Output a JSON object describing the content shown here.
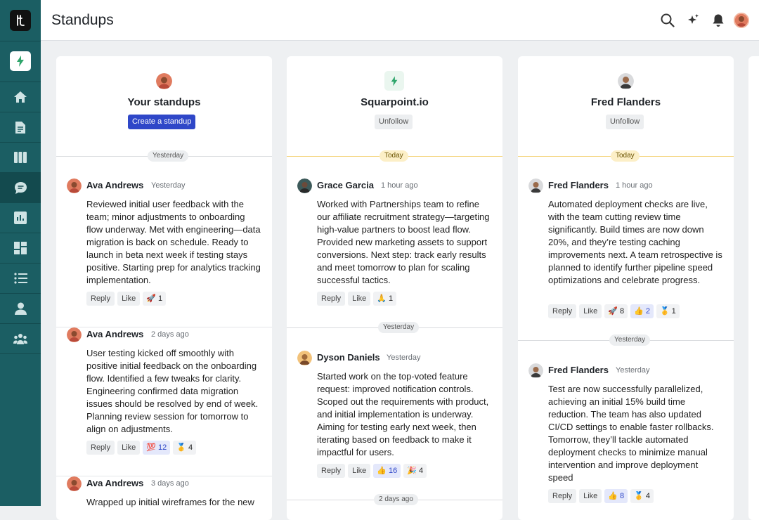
{
  "app": {
    "title": "Standups"
  },
  "colors": {
    "rail": "#1b5e63",
    "primary": "#2f47c8",
    "today": "#f4d174"
  },
  "rail_icons": [
    "home-icon",
    "document-icon",
    "board-icon",
    "chat-icon",
    "chart-icon",
    "dashboard-icon",
    "list-icon",
    "person-icon",
    "team-icon"
  ],
  "columns": [
    {
      "title": "Your standups",
      "button": "Create a standup",
      "first_divider": "Yesterday",
      "entries": [
        {
          "author": "Ava Andrews",
          "time": "Yesterday",
          "body": "Reviewed initial user feedback with the team; minor adjustments to onboarding flow underway. Met with engineering—data migration is back on schedule. Ready to launch in beta next week if testing stays positive. Starting prep for analytics tracking implementation.",
          "reactions": [
            {
              "emoji": "🚀",
              "count": "1",
              "mine": false
            }
          ]
        },
        {
          "author": "Ava Andrews",
          "time": "2 days ago",
          "body": "User testing kicked off smoothly with positive initial feedback on the onboarding flow. Identified a few tweaks for clarity. Engineering confirmed data migration issues should be resolved by end of week. Planning review session for tomorrow to align on adjustments.",
          "reactions": [
            {
              "emoji": "💯",
              "count": "12",
              "mine": true
            },
            {
              "emoji": "🥇",
              "count": "4",
              "mine": false
            }
          ]
        },
        {
          "author": "Ava Andrews",
          "time": "3 days ago",
          "body": "Wrapped up initial wireframes for the new",
          "reactions": []
        }
      ]
    },
    {
      "title": "Squarpoint.io",
      "button": "Unfollow",
      "first_divider": "Today",
      "entries": [
        {
          "author": "Grace Garcia",
          "time": "1 hour ago",
          "body": "Worked with Partnerships team to refine our affiliate recruitment strategy—targeting high-value partners to boost lead flow. Provided new marketing assets to support conversions. Next step: track early results and meet tomorrow to plan for scaling successful tactics.",
          "reactions": [
            {
              "emoji": "🙏",
              "count": "1",
              "mine": false
            }
          ]
        },
        {
          "author": "Dyson Daniels",
          "time": "Yesterday",
          "body": "Started work on the top-voted feature request: improved notification controls. Scoped out the requirements with product, and initial implementation is underway. Aiming for testing early next week, then iterating based on feedback to make it impactful for users.",
          "reactions": [
            {
              "emoji": "👍",
              "count": "16",
              "mine": true
            },
            {
              "emoji": "🎉",
              "count": "4",
              "mine": false
            }
          ]
        }
      ],
      "dividers": [
        "Yesterday",
        "2 days ago"
      ]
    },
    {
      "title": "Fred Flanders",
      "button": "Unfollow",
      "first_divider": "Today",
      "entries": [
        {
          "author": "Fred Flanders",
          "time": "1 hour ago",
          "body": "Automated deployment checks are live, with the team cutting review time significantly. Build times are now down 20%, and they’re testing caching improvements next. A team retrospective is planned to identify further pipeline speed optimizations and celebrate progress.",
          "reactions": [
            {
              "emoji": "🚀",
              "count": "8",
              "mine": false
            },
            {
              "emoji": "👍",
              "count": "2",
              "mine": true
            },
            {
              "emoji": "🥇",
              "count": "1",
              "mine": false
            }
          ]
        },
        {
          "author": "Fred Flanders",
          "time": "Yesterday",
          "body": "Test are now successfully parallelized, achieving an initial 15% build time reduction. The team has also updated CI/CD settings to enable faster rollbacks. Tomorrow, they’ll tackle automated deployment checks to minimize manual intervention and improve deployment speed",
          "reactions": [
            {
              "emoji": "👍",
              "count": "8",
              "mine": true
            },
            {
              "emoji": "🥇",
              "count": "4",
              "mine": false
            }
          ]
        }
      ],
      "dividers": [
        "Yesterday"
      ]
    }
  ],
  "labels": {
    "reply": "Reply",
    "like": "Like"
  }
}
